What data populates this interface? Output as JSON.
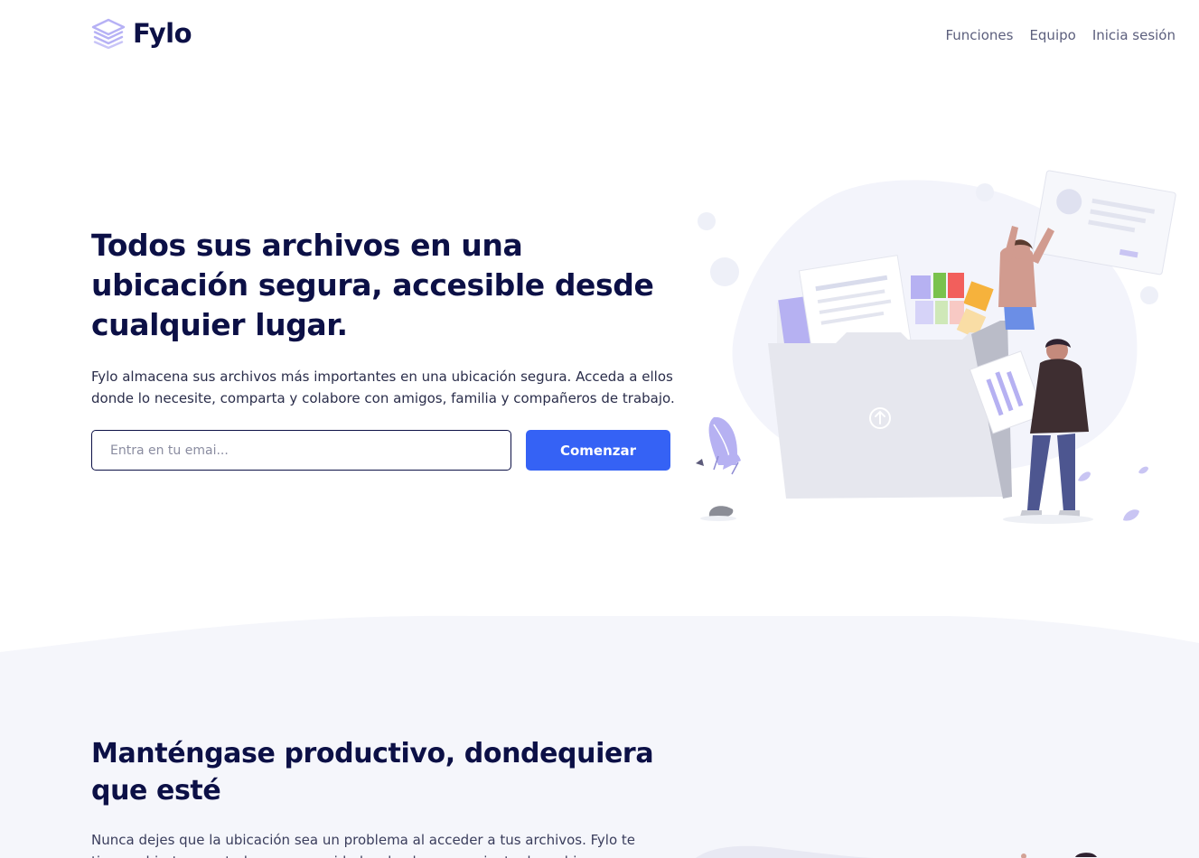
{
  "brand": {
    "name": "Fylo",
    "accent": "#3562f5",
    "text_dark": "#0c1046"
  },
  "nav": {
    "items": [
      {
        "label": "Funciones"
      },
      {
        "label": "Equipo"
      },
      {
        "label": "Inicia sesión"
      }
    ]
  },
  "hero": {
    "title": "Todos sus archivos en una ubicación segura, accesible desde cualquier lugar.",
    "description": "Fylo almacena sus archivos más importantes en una ubicación segura. Acceda a ellos donde lo necesite, comparta y colabore con amigos, familia y compañeros de trabajo.",
    "email_placeholder": "Entra en tu emai...",
    "email_value": "",
    "cta_label": "Comenzar"
  },
  "productive": {
    "title": "Manténgase productivo, dondequiera que esté",
    "description": "Nunca dejes que la ubicación sea un problema al acceder a tus archivos. Fylo te tiene cubierto para todas sus necesidades de almacenamiento de archivos."
  },
  "icons": {
    "logo": "stacked-layers-icon"
  }
}
